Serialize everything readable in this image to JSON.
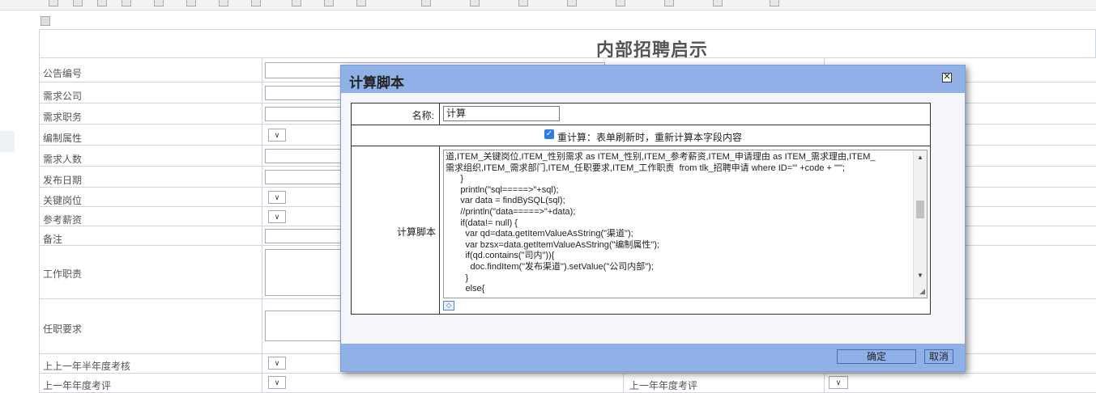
{
  "form": {
    "title": "内部招聘启示",
    "rows": [
      {
        "label": "公告编号"
      },
      {
        "label": "需求公司"
      },
      {
        "label": "需求职务"
      },
      {
        "label": "编制属性"
      },
      {
        "label": "需求人数"
      },
      {
        "label": "发布日期"
      },
      {
        "label": "关键岗位"
      },
      {
        "label": "参考薪资"
      },
      {
        "label": "备注"
      },
      {
        "label": "工作职责"
      },
      {
        "label": "任职要求"
      },
      {
        "label": "上上一年半年度考核"
      },
      {
        "label": "上一年年度考评"
      }
    ],
    "right_label_last": "上一年年度考评"
  },
  "dialog": {
    "title": "计算脚本",
    "name_label": "名称:",
    "name_value": "计算",
    "recalc_text": "重计算：表单刷新时，重新计算本字段内容",
    "recalc_checked": true,
    "script_label": "计算脚本",
    "script_lines": [
      "道,ITEM_关键岗位,ITEM_性别需求 as ITEM_性别,ITEM_参考薪资,ITEM_申请理由 as ITEM_需求理由,ITEM_",
      "需求组织,ITEM_需求部门,ITEM_任职要求,ITEM_工作职责  from tlk_招聘申请 where ID='\" +code + \"'\";",
      "      }",
      "      println(\"sql=====>\"+sql);",
      "      var data = findBySQL(sql);",
      "      //println(\"data=====>\"+data);",
      "      if(data!= null) {",
      "        var qd=data.getItemValueAsString(\"渠道\");",
      "        var bzsx=data.getItemValueAsString(\"编制属性\");",
      "        if(qd.contains(\"司内\")){",
      "          doc.findItem(\"发布渠道\").setValue(\"公司内部\");",
      "        }",
      "        else{"
    ],
    "ok_label": "确定",
    "cancel_label": "取消"
  },
  "icons": {
    "close": "close-icon",
    "expand": "expand-icon",
    "scroll_up": "scroll-up-icon",
    "scroll_down": "scroll-down-icon"
  }
}
